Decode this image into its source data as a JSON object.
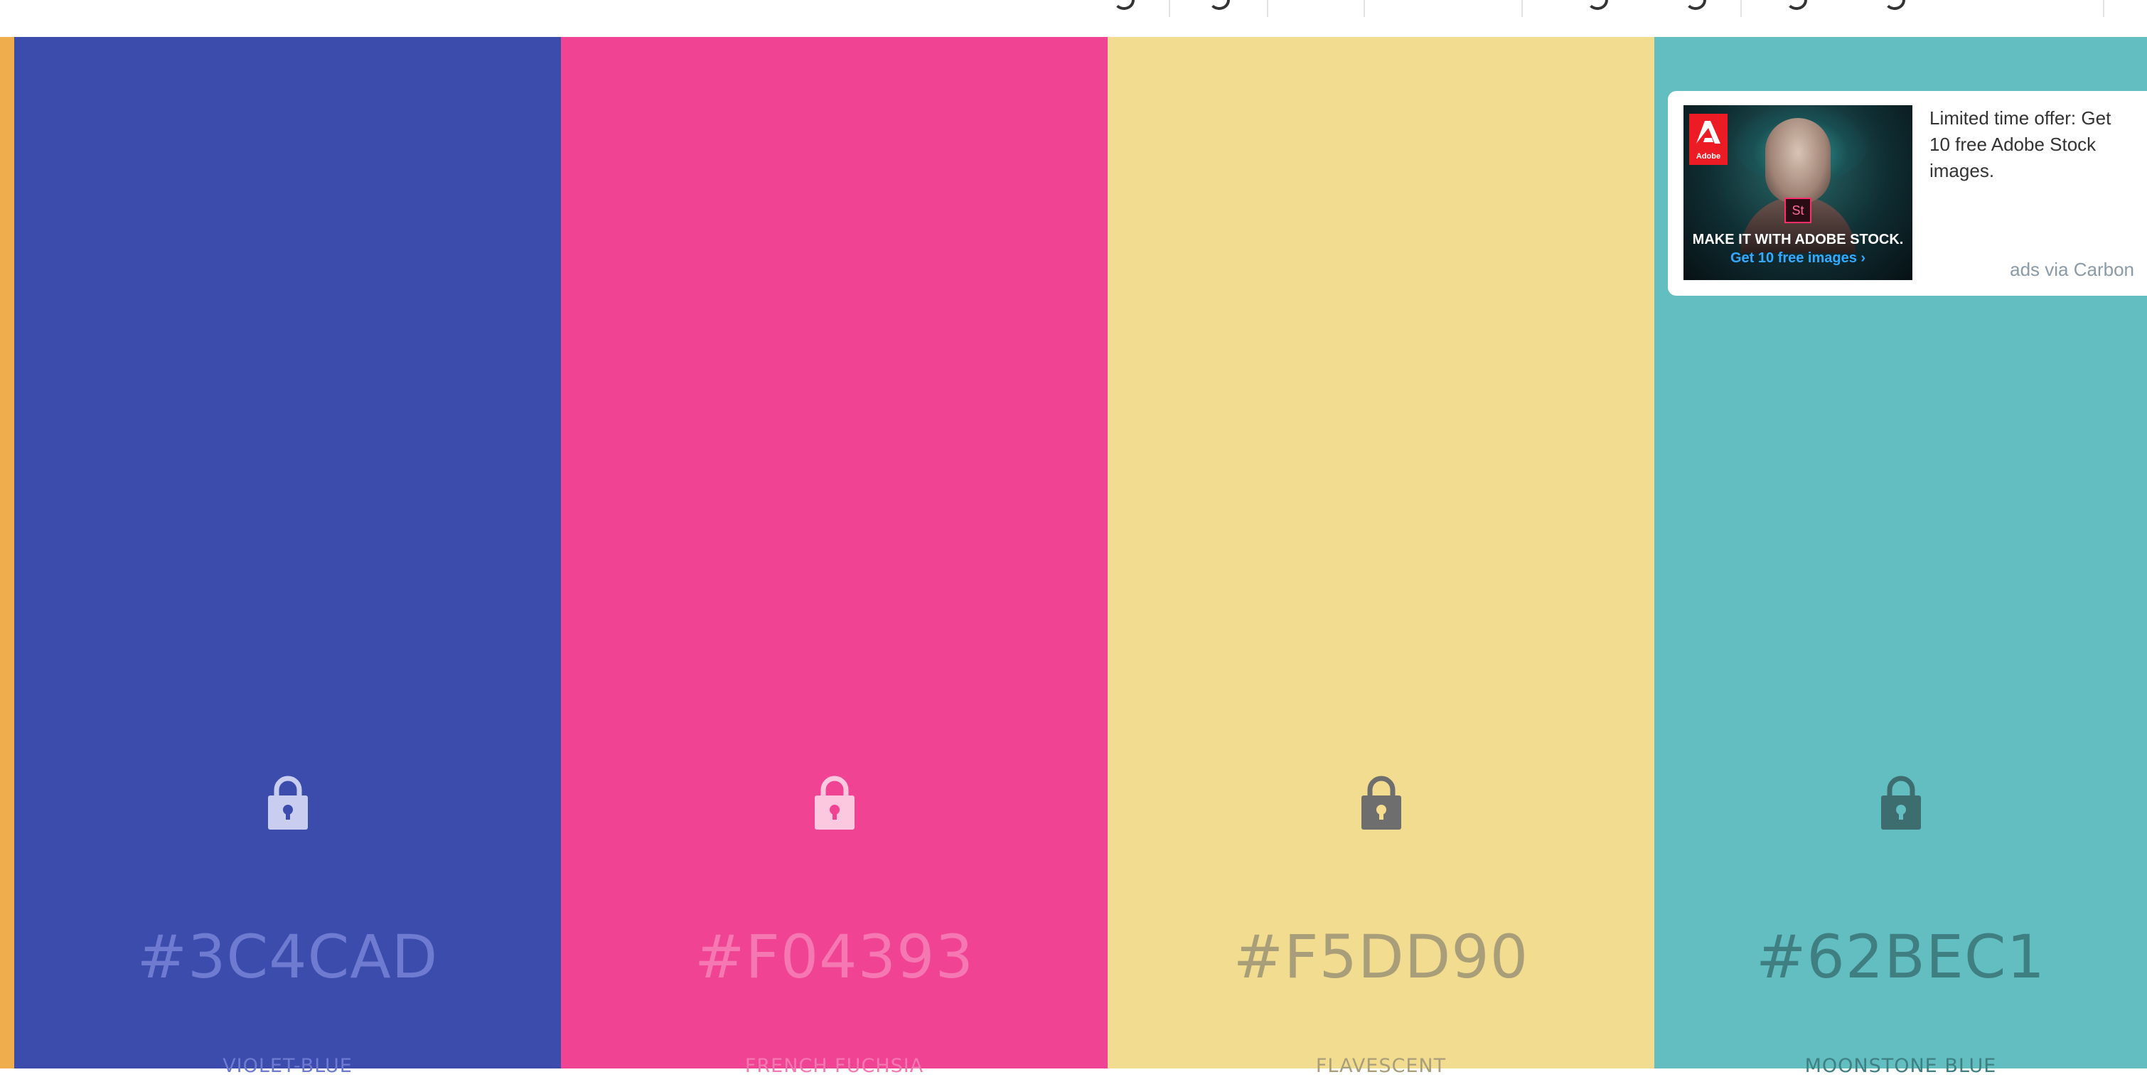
{
  "palette": {
    "accent_color": "#F0AD4E",
    "colors": [
      {
        "hex": "#3C4CAD",
        "name": "VIOLET-BLUE",
        "bg": "#3C4CAD",
        "text_color": "#6E7BD0",
        "lock_color": "#C9CEF0",
        "lock_dot": "#3C4CAD"
      },
      {
        "hex": "#F04393",
        "name": "FRENCH FUCHSIA",
        "bg": "#F04393",
        "text_color": "#F678B3",
        "lock_color": "#FBC8DF",
        "lock_dot": "#F04393"
      },
      {
        "hex": "#F5DD90",
        "name": "FLAVESCENT",
        "bg": "#F2DC90",
        "text_color": "#A89E7A",
        "lock_color": "#6E6E6E",
        "lock_dot": "#F5DD90"
      },
      {
        "hex": "#62BEC1",
        "name": "MOONSTONE BLUE",
        "bg": "#62BEC1",
        "text_color": "#3F7F82",
        "lock_color": "#3E6D70",
        "lock_dot": "#62BEC1"
      }
    ]
  },
  "ad": {
    "text": "Limited time offer: Get 10 free Adobe Stock images.",
    "via": "ads via Carbon",
    "image_headline": "MAKE IT WITH ADOBE STOCK.",
    "image_cta": "Get 10 free images ›",
    "image_brand": "Adobe",
    "image_badge": "St"
  }
}
